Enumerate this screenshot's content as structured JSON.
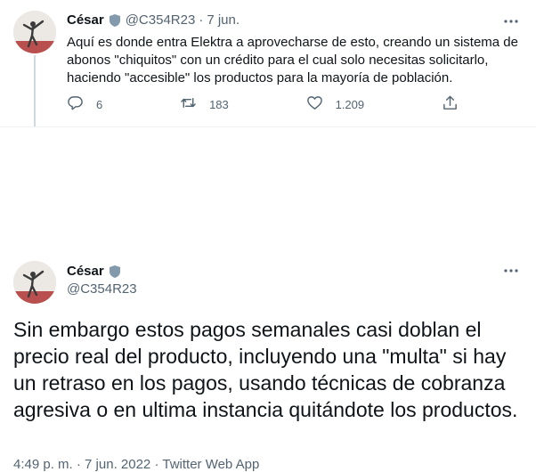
{
  "previous_tweet": {
    "name": "César",
    "handle": "@C354R23",
    "date": "7 jun.",
    "text": "Aquí es donde entra Elektra a aprovecharse de esto, creando un sistema de abonos \"chiquitos\" con un crédito para el cual solo necesitas solicitarlo, haciendo \"accesible\" los productos para la mayoría de población.",
    "replies": "6",
    "retweets": "183",
    "likes": "1.209"
  },
  "main_tweet": {
    "name": "César",
    "handle": "@C354R23",
    "text": "Sin embargo estos pagos semanales casi doblan el precio real del producto, incluyendo una \"multa\" si hay un retraso en los pagos, usando técnicas de cobranza agresiva o en ultima instancia quitándote los productos.",
    "time": "4:49 p. m.",
    "date": "7 jun. 2022",
    "source": "Twitter Web App"
  },
  "colors": {
    "text": "#0f1419",
    "muted": "#536471",
    "badge": "#829aab",
    "divider": "#eff3f4"
  },
  "icons": [
    "verified-badge-icon",
    "more-icon",
    "reply-icon",
    "retweet-icon",
    "like-icon",
    "share-icon"
  ]
}
